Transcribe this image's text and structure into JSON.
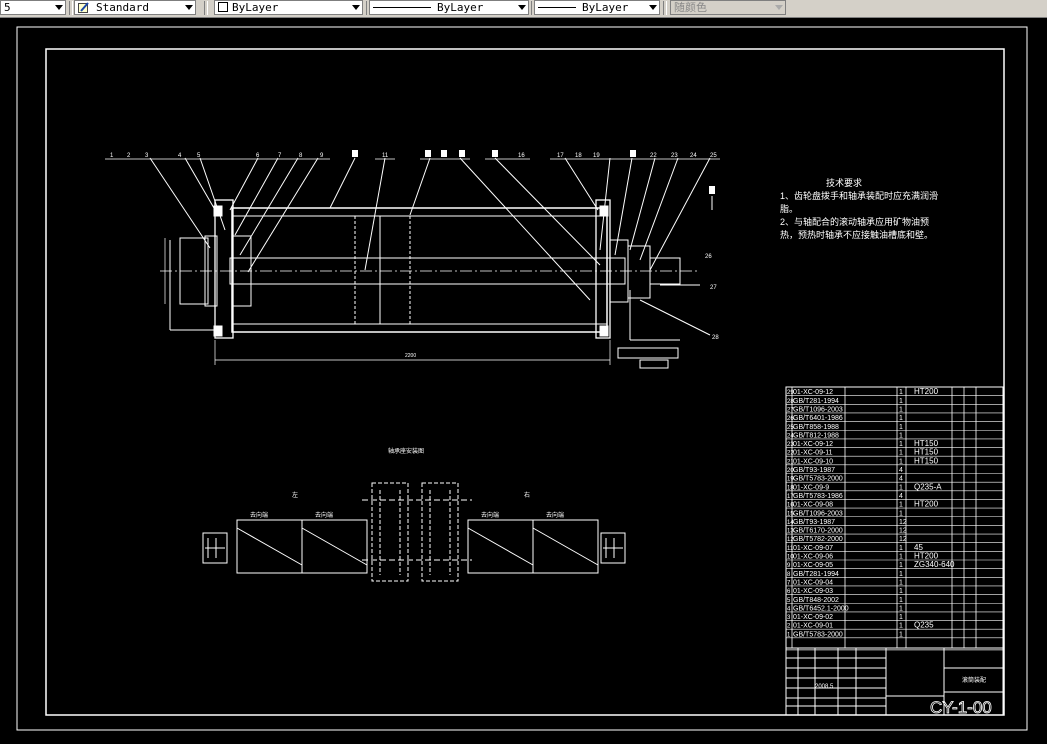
{
  "toolbar": {
    "scale_value": "5",
    "text_style": "Standard",
    "layer_color": "ByLayer",
    "linetype": "ByLayer",
    "lineweight": "ByLayer",
    "plot_style": "随颜色"
  },
  "drawing": {
    "tech_requirements": {
      "title": "技术要求",
      "lines": [
        "1、齿轮盘拨手和轴承装配时应充满润滑",
        "脂。",
        "2、与轴配合的滚动轴承应用矿物油预",
        "热，预热时轴承不应接触油槽底和壁。"
      ]
    },
    "callouts_left": [
      "1",
      "2",
      "3",
      "4",
      "5",
      "6",
      "7",
      "8",
      "9",
      "11"
    ],
    "callouts_right": [
      "16",
      "17",
      "18",
      "19",
      "22",
      "23",
      "24",
      "25"
    ],
    "side_callouts": [
      "26",
      "27",
      "28"
    ],
    "detail_title": "轴承座安装图",
    "detail_labels": [
      "左",
      "右",
      "去向端",
      "去向端",
      "去向端",
      "去向端"
    ],
    "bom": [
      {
        "code": "01-XC-09-12",
        "qty": "1",
        "mat": "HT200"
      },
      {
        "code": "GB/T281-1994",
        "qty": "1",
        "mat": ""
      },
      {
        "code": "GB/T1096-2003",
        "qty": "1",
        "mat": ""
      },
      {
        "code": "GB/T6401-1986",
        "qty": "1",
        "mat": ""
      },
      {
        "code": "GB/T858-1988",
        "qty": "1",
        "mat": ""
      },
      {
        "code": "GB/T812-1988",
        "qty": "1",
        "mat": ""
      },
      {
        "code": "01-XC-09-12",
        "qty": "1",
        "mat": "HT150"
      },
      {
        "code": "01-XC-09-11",
        "qty": "1",
        "mat": "HT150"
      },
      {
        "code": "01-XC-09-10",
        "qty": "1",
        "mat": "HT150"
      },
      {
        "code": "GB/T93-1987",
        "qty": "4",
        "mat": ""
      },
      {
        "code": "GB/T5783-2000",
        "qty": "4",
        "mat": ""
      },
      {
        "code": "01-XC-09-9",
        "qty": "1",
        "mat": "Q235-A"
      },
      {
        "code": "GB/T5783-1986",
        "qty": "4",
        "mat": ""
      },
      {
        "code": "01-XC-09-08",
        "qty": "1",
        "mat": "HT200"
      },
      {
        "code": "GB/T1096-2003",
        "qty": "1",
        "mat": ""
      },
      {
        "code": "GB/T93-1987",
        "qty": "12",
        "mat": ""
      },
      {
        "code": "GB/T6170-2000",
        "qty": "12",
        "mat": ""
      },
      {
        "code": "GB/T5782-2000",
        "qty": "12",
        "mat": ""
      },
      {
        "code": "01-XC-09-07",
        "qty": "1",
        "mat": "45"
      },
      {
        "code": "01-XC-09-06",
        "qty": "1",
        "mat": "HT200"
      },
      {
        "code": "01-XC-09-05",
        "qty": "1",
        "mat": "ZG340-640"
      },
      {
        "code": "GB/T281-1994",
        "qty": "1",
        "mat": ""
      },
      {
        "code": "01-XC-09-04",
        "qty": "1",
        "mat": ""
      },
      {
        "code": "01-XC-09-03",
        "qty": "1",
        "mat": ""
      },
      {
        "code": "GB/T848-2002",
        "qty": "1",
        "mat": ""
      },
      {
        "code": "GB/T6452.1-2000",
        "qty": "1",
        "mat": ""
      },
      {
        "code": "01-XC-09-02",
        "qty": "1",
        "mat": ""
      },
      {
        "code": "01-XC-09-01",
        "qty": "1",
        "mat": "Q235"
      },
      {
        "code": "GB/T5783-2000",
        "qty": "1",
        "mat": ""
      }
    ],
    "title_block": {
      "drawing_title": "滚筒装配",
      "date": "2008.5",
      "drawing_number": "CY-1-00"
    }
  }
}
